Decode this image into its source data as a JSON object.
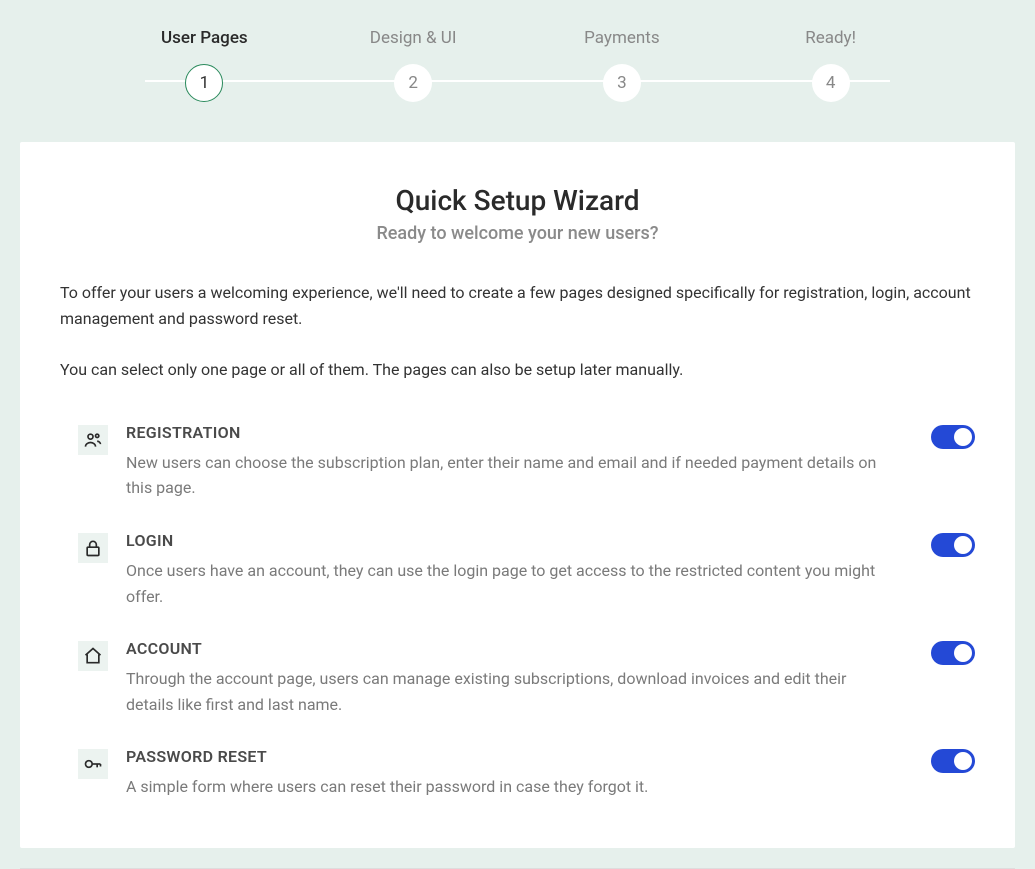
{
  "stepper": {
    "steps": [
      {
        "label": "User Pages",
        "number": "1",
        "active": true
      },
      {
        "label": "Design & UI",
        "number": "2",
        "active": false
      },
      {
        "label": "Payments",
        "number": "3",
        "active": false
      },
      {
        "label": "Ready!",
        "number": "4",
        "active": false
      }
    ]
  },
  "wizard": {
    "title": "Quick Setup Wizard",
    "subtitle": "Ready to welcome your new users?",
    "intro1": "To offer your users a welcoming experience, we'll need to create a few pages designed specifically for registration, login, account management and password reset.",
    "intro2": "You can select only one page or all of them. The pages can also be setup later manually."
  },
  "options": [
    {
      "key": "registration",
      "title": "REGISTRATION",
      "desc": "New users can choose the subscription plan, enter their name and email and if needed payment details on this page.",
      "enabled": true
    },
    {
      "key": "login",
      "title": "LOGIN",
      "desc": "Once users have an account, they can use the login page to get access to the restricted content you might offer.",
      "enabled": true
    },
    {
      "key": "account",
      "title": "ACCOUNT",
      "desc": "Through the account page, users can manage existing subscriptions, download invoices and edit their details like first and last name.",
      "enabled": true
    },
    {
      "key": "password-reset",
      "title": "PASSWORD RESET",
      "desc": "A simple form where users can reset their password in case they forgot it.",
      "enabled": true
    }
  ]
}
